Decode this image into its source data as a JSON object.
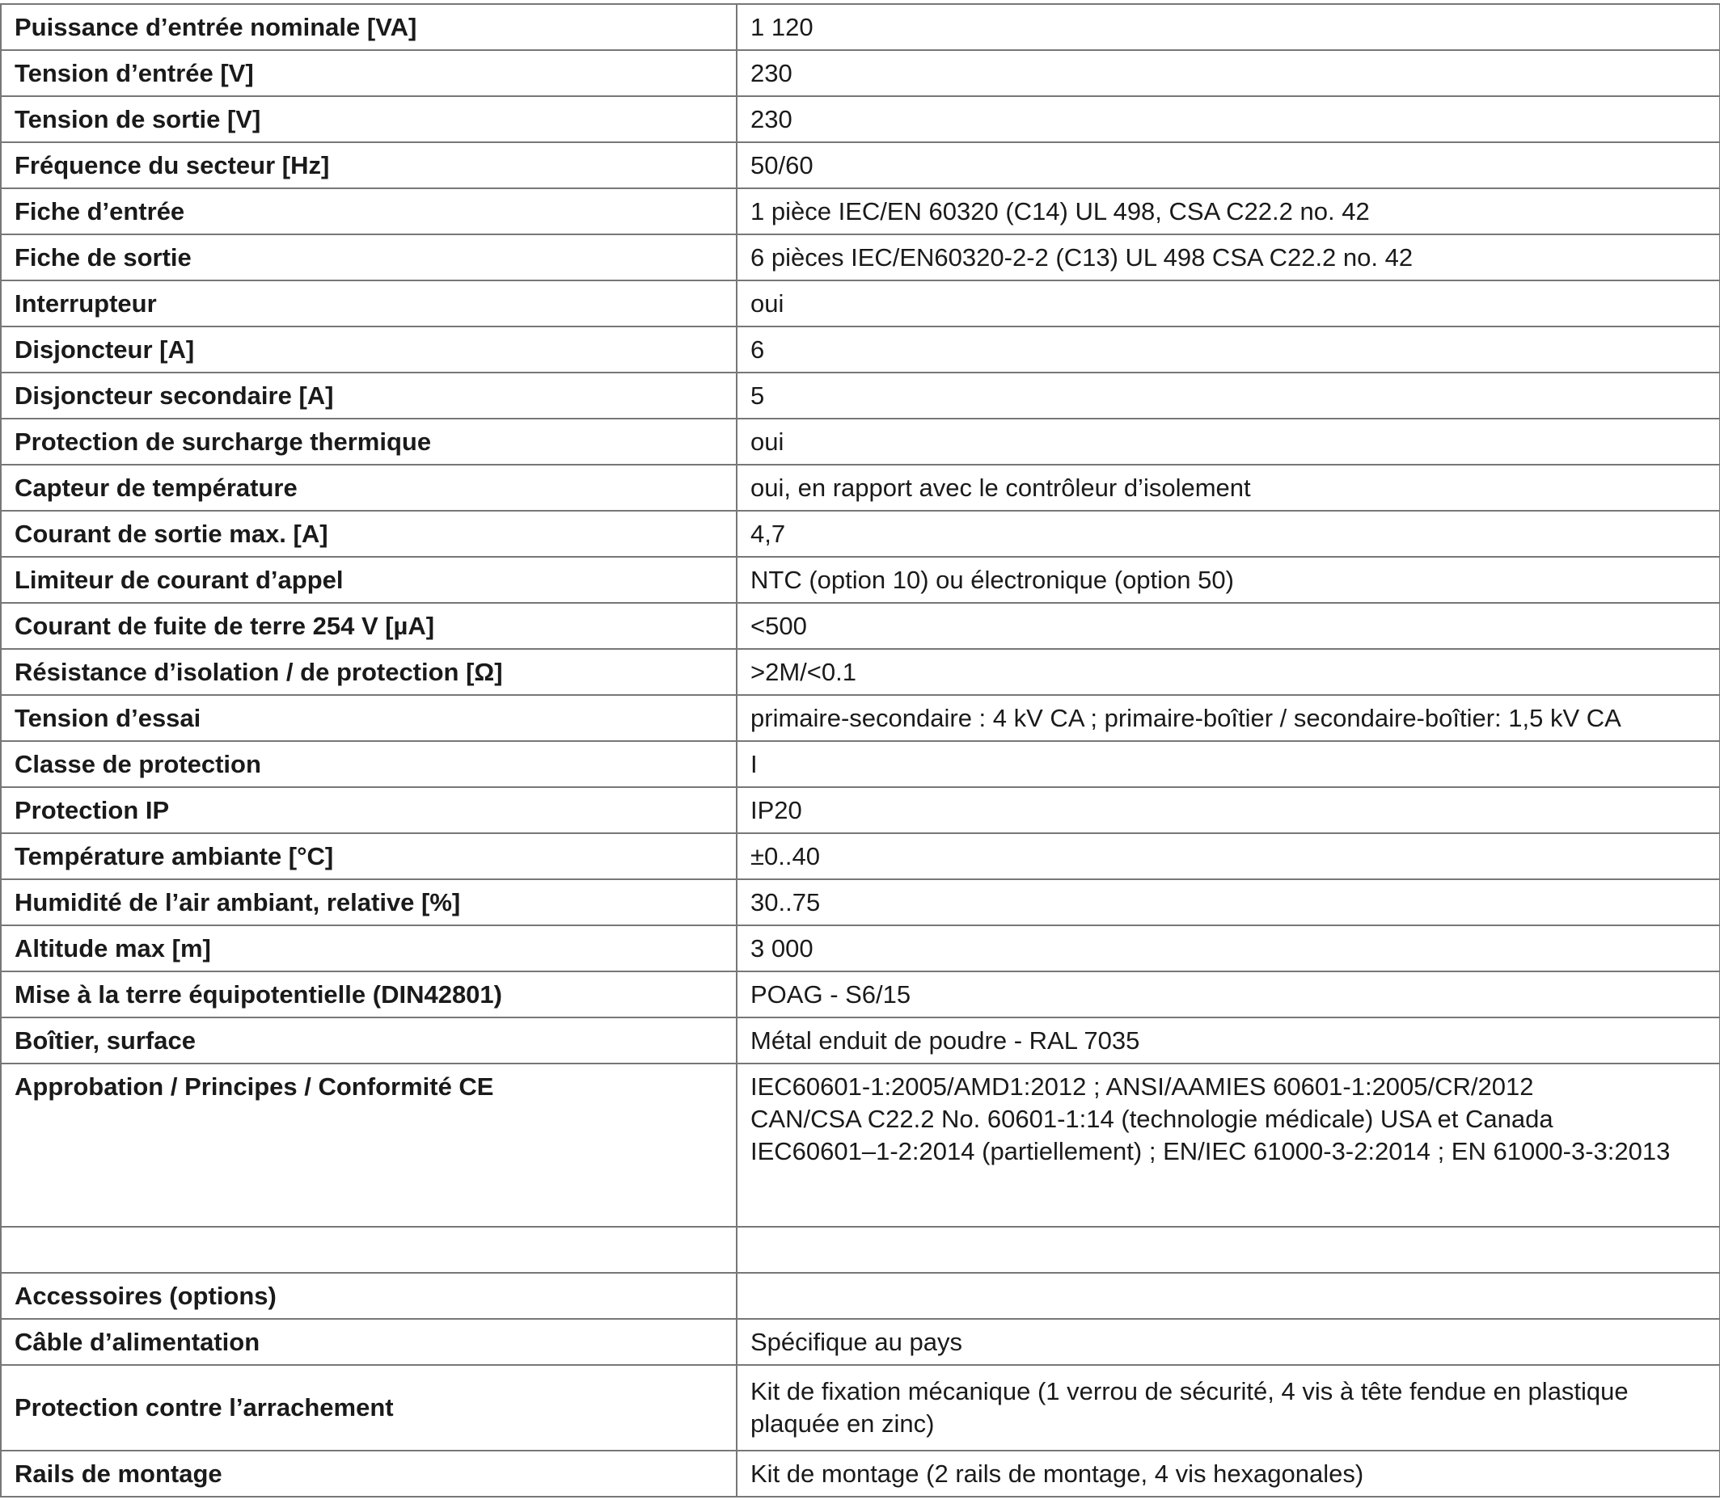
{
  "rows": [
    {
      "label": "Puissance d’entrée nominale [VA]",
      "value": "1 120"
    },
    {
      "label": "Tension d’entrée [V]",
      "value": "230"
    },
    {
      "label": "Tension de sortie [V]",
      "value": "230"
    },
    {
      "label": "Fréquence du secteur [Hz]",
      "value": "50/60"
    },
    {
      "label": "Fiche d’entrée",
      "value": "1 pièce IEC/EN 60320 (C14) UL 498, CSA C22.2 no. 42"
    },
    {
      "label": "Fiche de sortie",
      "value": "6 pièces IEC/EN60320-2-2 (C13) UL 498 CSA C22.2 no. 42"
    },
    {
      "label": "Interrupteur",
      "value": "oui"
    },
    {
      "label": "Disjoncteur [A]",
      "value": "6"
    },
    {
      "label": "Disjoncteur secondaire [A]",
      "value": "5"
    },
    {
      "label": "Protection de surcharge thermique",
      "value": "oui"
    },
    {
      "label": "Capteur de température",
      "value": "oui, en rapport avec le contrôleur d’isolement"
    },
    {
      "label": "Courant de sortie max. [A]",
      "value": "4,7"
    },
    {
      "label": "Limiteur de courant d’appel",
      "value": "NTC (option 10) ou électronique (option 50)"
    },
    {
      "label": "Courant de fuite de terre 254 V [µA]",
      "value": "<500"
    },
    {
      "label": "Résistance d’isolation / de protection [Ω]",
      "value": ">2M/<0.1"
    },
    {
      "label": "Tension d’essai",
      "value": "primaire-secondaire : 4 kV CA ; primaire-boîtier / secondaire-boîtier: 1,5 kV CA"
    },
    {
      "label": "Classe de protection",
      "value": "I"
    },
    {
      "label": "Protection IP",
      "value": "IP20"
    },
    {
      "label": "Température ambiante [°C]",
      "value": "±0..40"
    },
    {
      "label": "Humidité de l’air ambiant, relative [%]",
      "value": "30..75"
    },
    {
      "label": "Altitude max [m]",
      "value": "3 000"
    },
    {
      "label": "Mise à la terre équipotentielle (DIN42801)",
      "value": "POAG - S6/15"
    },
    {
      "label": "Boîtier, surface",
      "value": "Métal enduit de poudre - RAL 7035"
    }
  ],
  "approval": {
    "label": "Approbation / Principes / Conformité CE",
    "lines": [
      "IEC60601-1:2005/AMD1:2012 ; ANSI/AAMIES 60601-1:2005/CR/2012",
      "CAN/CSA C22.2 No. 60601-1:14 (technologie médicale) USA et Canada",
      "IEC60601–1-2:2014 (partiellement) ; EN/IEC 61000-3-2:2014 ; EN 61000-3-3:2013"
    ]
  },
  "empty_row": {
    "label": "",
    "value": ""
  },
  "accessories": {
    "header": {
      "label": "Accessoires (options)",
      "value": ""
    },
    "cable": {
      "label": "Câble d’alimentation",
      "value": "Spécifique au pays"
    },
    "strain_relief": {
      "label": "Protection contre l’arrachement",
      "lines": [
        "Kit de fixation mécanique (1 verrou de sécurité, 4 vis à tête fendue en plastique",
        "plaquée en zinc)"
      ]
    },
    "rails": {
      "label": "Rails de montage",
      "value": "Kit de montage (2 rails de montage, 4 vis hexagonales)"
    }
  }
}
